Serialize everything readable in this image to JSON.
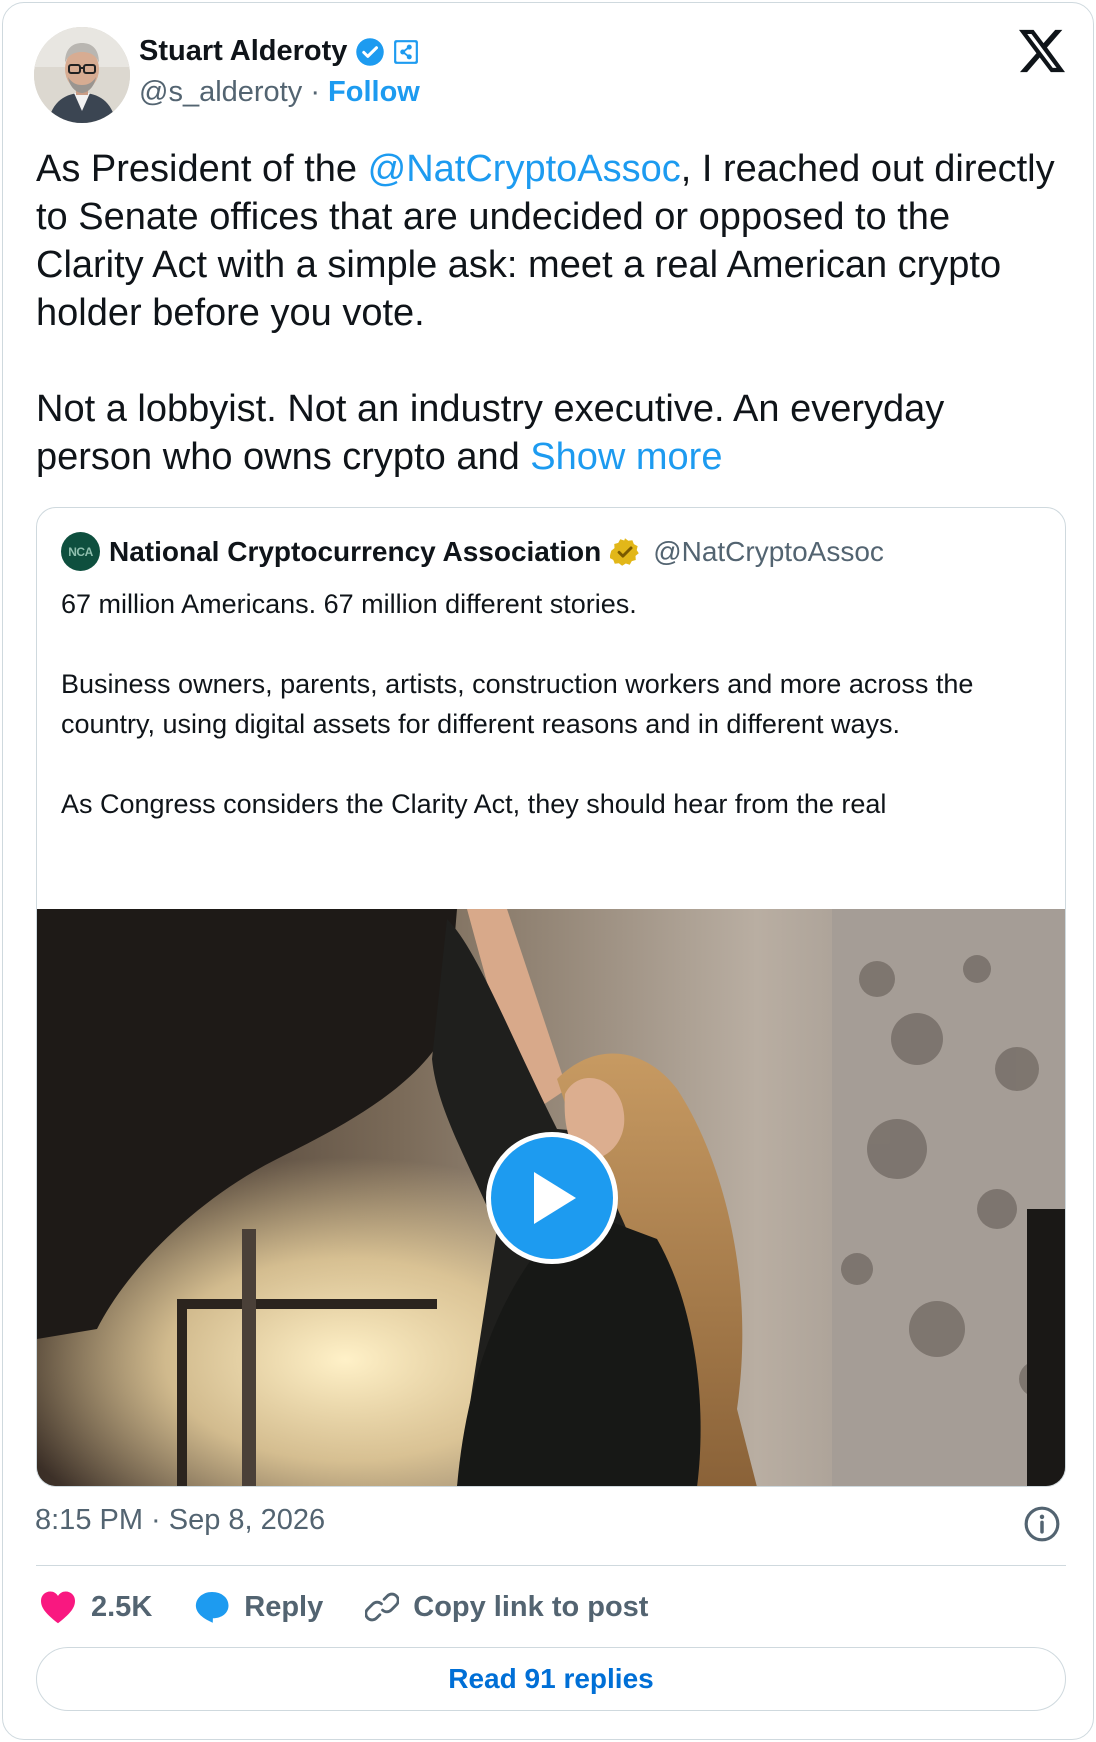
{
  "author": {
    "name": "Stuart Alderoty",
    "handle": "@s_alderoty",
    "separator": "·",
    "follow_label": "Follow"
  },
  "tweet": {
    "p1_before": "As President of the ",
    "p1_mention": "@NatCryptoAssoc",
    "p1_after": ", I reached out directly to Senate offices that are undecided or opposed to the Clarity Act with a simple ask: meet a real American crypto holder before you vote.",
    "p2_text": "Not a lobbyist. Not an industry executive. An everyday person who owns crypto and ",
    "show_more": "Show more"
  },
  "quoted": {
    "logo_text": "NCA",
    "name": "National Cryptocurrency Association",
    "handle": "@NatCryptoAssoc",
    "para1": "67 million Americans. 67 million different stories.",
    "para2": "Business owners, parents, artists, construction workers and more across the country, using digital assets for different reasons and in different ways.",
    "para3": "As Congress considers the Clarity Act, they should hear from the real"
  },
  "meta": {
    "timestamp": "8:15 PM · Sep 8, 2026"
  },
  "actions": {
    "like_count": "2.5K",
    "reply_label": "Reply",
    "copy_label": "Copy link to post"
  },
  "read_replies_label": "Read 91 replies",
  "colors": {
    "accent": "#1d9bf0",
    "like": "#f91880",
    "link_dark": "#006fd6",
    "gold_badge": "#e2b719"
  },
  "icons": [
    "verified-badge-icon",
    "affiliate-badge-icon",
    "x-logo-icon",
    "gold-verified-badge-icon",
    "play-icon",
    "info-icon",
    "heart-icon",
    "reply-bubble-icon",
    "link-icon"
  ]
}
